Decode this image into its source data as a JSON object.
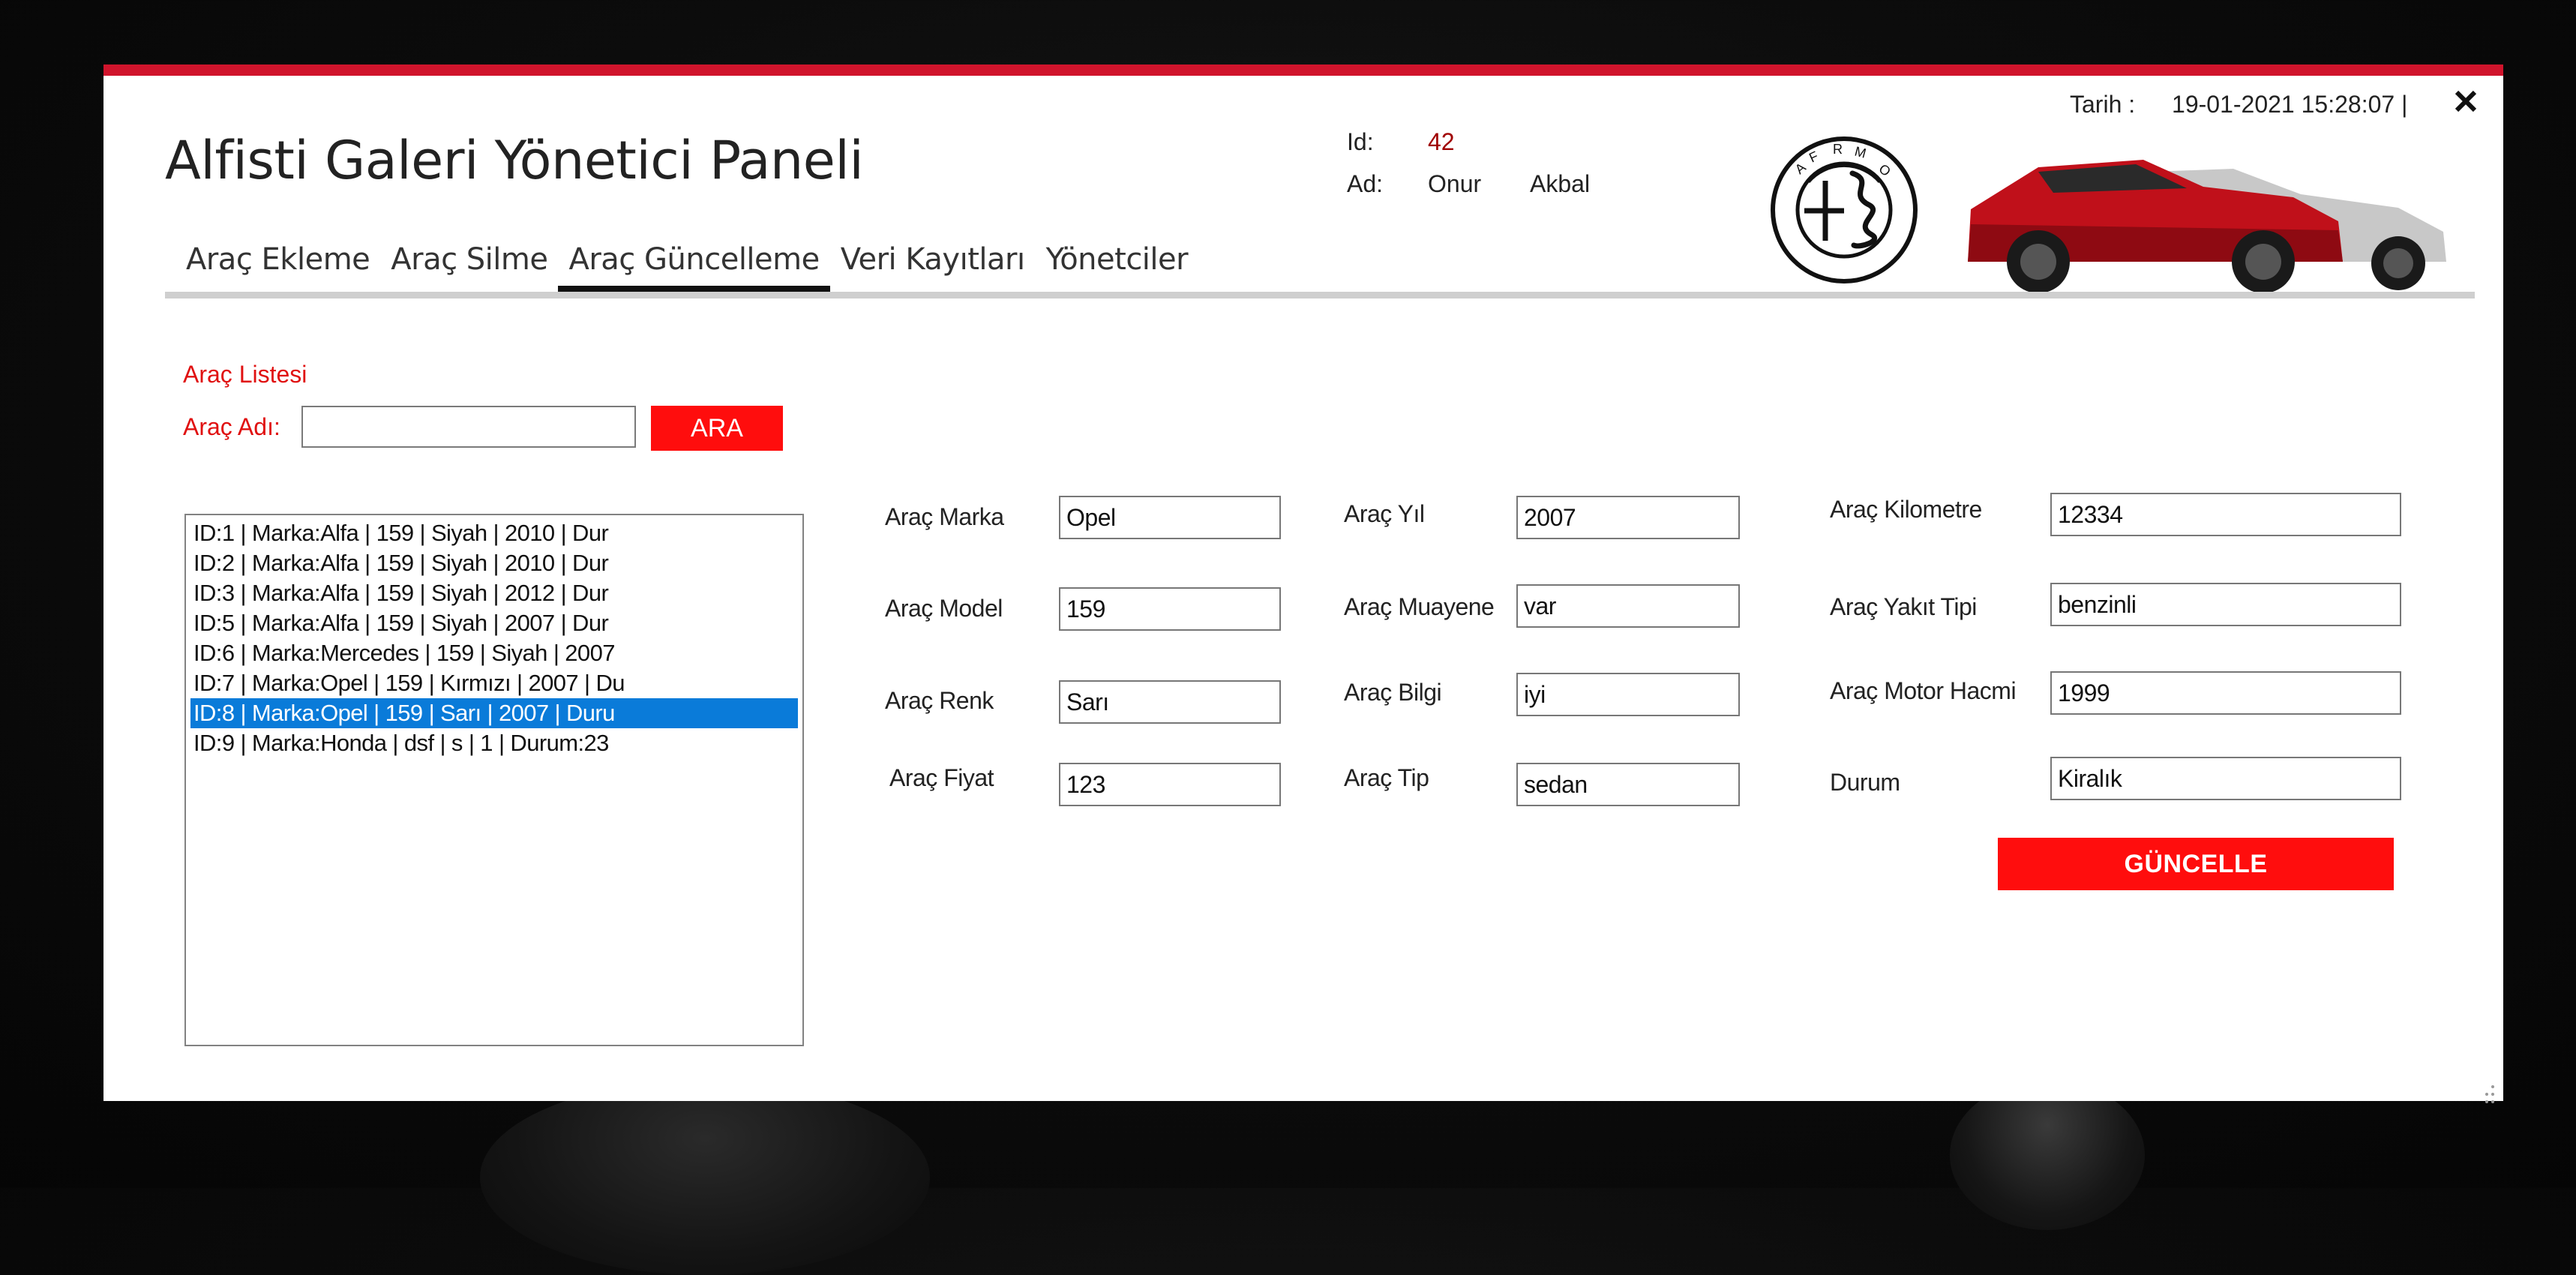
{
  "window": {
    "title": "Alfisti Galeri Yönetici Paneli",
    "accent_color": "#d0142c",
    "button_color": "#ff0d0d",
    "selection_color": "#0a7bd9"
  },
  "tabs": [
    {
      "label": "Araç Ekleme",
      "active": false
    },
    {
      "label": "Araç Silme",
      "active": false
    },
    {
      "label": "Araç Güncelleme",
      "active": true
    },
    {
      "label": "Veri Kayıtları",
      "active": false
    },
    {
      "label": "Yönetciler",
      "active": false
    }
  ],
  "user": {
    "id_label": "Id:",
    "id_value": "42",
    "name_label": "Ad:",
    "first_name": "Onur",
    "last_name": "Akbal"
  },
  "datetime": {
    "label": "Tarih :",
    "value": "19-01-2021 15:28:07 |"
  },
  "icons": {
    "close": "close-icon",
    "logo": "alfa-romeo-logo",
    "car": "car-image",
    "resize": "resize-grip-icon"
  },
  "search": {
    "list_title": "Araç Listesi",
    "name_label": "Araç Adı:",
    "value": "",
    "button_label": "ARA"
  },
  "car_list": {
    "selected_index": 6,
    "items": [
      "ID:1 | Marka:Alfa   |   159   |   Siyah   |   2010  |  Dur",
      "ID:2 | Marka:Alfa   |   159   |   Siyah   |   2010  |  Dur",
      "ID:3 | Marka:Alfa   |   159   |   Siyah   |   2012  |  Dur",
      "ID:5 | Marka:Alfa   |   159   |   Siyah   |   2007  |  Dur",
      "ID:6 | Marka:Mercedes   |   159   |   Siyah   |   2007",
      "ID:7 | Marka:Opel   |   159   |   Kırmızı   |   2007  |  Du",
      "ID:8 | Marka:Opel   |   159   |   Sarı   |   2007  |  Duru",
      "ID:9 | Marka:Honda   |   dsf   |   s   |   1   |  Durum:23"
    ]
  },
  "form": {
    "marka": {
      "label": "Araç Marka",
      "value": "Opel"
    },
    "model": {
      "label": "Araç Model",
      "value": "159"
    },
    "renk": {
      "label": "Araç Renk",
      "value": "Sarı"
    },
    "fiyat": {
      "label": "Araç Fiyat",
      "value": "123"
    },
    "yil": {
      "label": "Araç Yıl",
      "value": "2007"
    },
    "muayene": {
      "label": "Araç Muayene",
      "value": "var"
    },
    "bilgi": {
      "label": "Araç Bilgi",
      "value": "iyi"
    },
    "tip": {
      "label": "Araç Tip",
      "value": "sedan"
    },
    "kilometre": {
      "label": "Araç Kilometre",
      "value": "12334"
    },
    "yakit": {
      "label": "Araç Yakıt Tipi",
      "value": "benzinli"
    },
    "motor": {
      "label": "Araç Motor Hacmi",
      "value": "1999"
    },
    "durum": {
      "label": "Durum",
      "value": "Kiralık"
    }
  },
  "update_button": {
    "label": "GÜNCELLE"
  }
}
